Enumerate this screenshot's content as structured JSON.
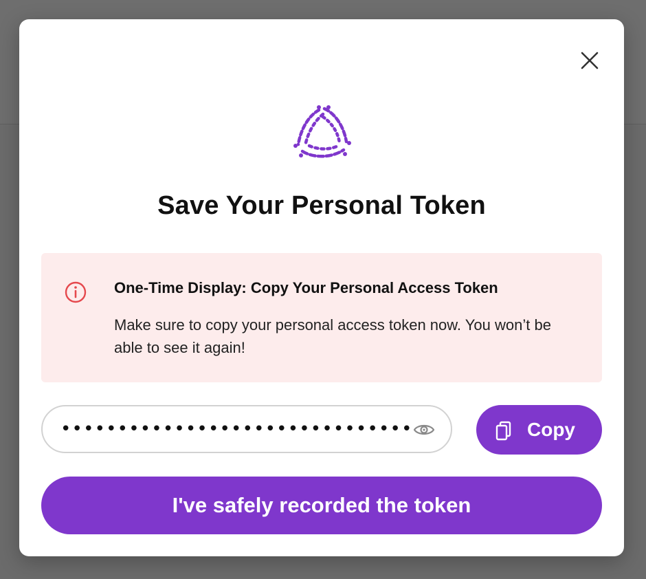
{
  "modal": {
    "title": "Save Your Personal Token",
    "close_icon": "close-icon",
    "logo": "triangle-circuit-logo",
    "alert": {
      "icon": "info-circle-icon",
      "title": "One-Time Display: Copy Your Personal Access Token",
      "body": "Make sure to copy your personal access token now. You won’t be able to see it again!"
    },
    "token_field": {
      "value": "•••••••••••••••••••••••••••••••",
      "reveal_icon": "eye-icon"
    },
    "copy_button": {
      "label": "Copy",
      "icon": "copy-icon"
    },
    "confirm_button": {
      "label": "I've safely recorded the token"
    }
  },
  "colors": {
    "accent": "#7f37cc",
    "alert_bg": "#fdecec",
    "alert_icon": "#e5484d",
    "overlay": "#6b6b6b"
  }
}
